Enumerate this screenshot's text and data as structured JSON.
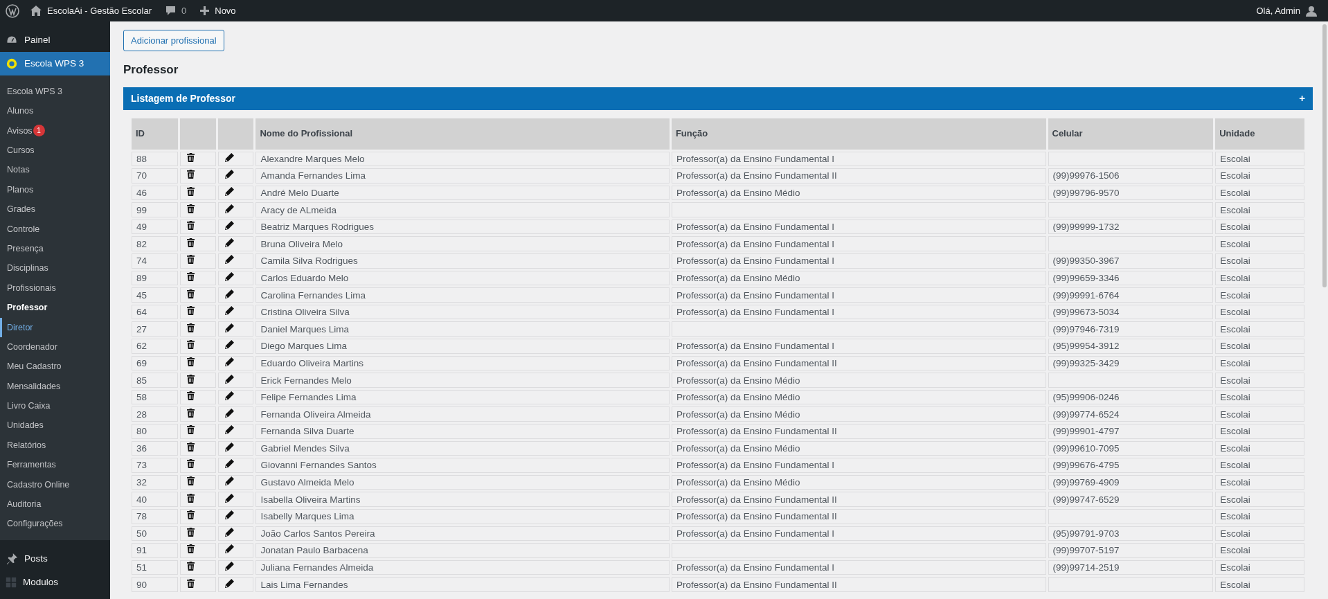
{
  "admin_bar": {
    "site_title": "EscolaAi - Gestão Escolar",
    "comments_count": "0",
    "new_label": "Novo",
    "greeting": "Olá, Admin"
  },
  "sidebar": {
    "items": [
      {
        "label": "Painel",
        "selected": false
      },
      {
        "label": "Escola WPS 3",
        "selected": true,
        "children": [
          {
            "label": "Escola WPS 3",
            "selected": false,
            "hovered": false
          },
          {
            "label": "Alunos",
            "selected": false,
            "hovered": false
          },
          {
            "label": "Avisos",
            "selected": false,
            "hovered": false,
            "badge": "1"
          },
          {
            "label": "Cursos",
            "selected": false,
            "hovered": false
          },
          {
            "label": "Notas",
            "selected": false,
            "hovered": false
          },
          {
            "label": "Planos",
            "selected": false,
            "hovered": false
          },
          {
            "label": "Grades",
            "selected": false,
            "hovered": false
          },
          {
            "label": "Controle",
            "selected": false,
            "hovered": false
          },
          {
            "label": "Presença",
            "selected": false,
            "hovered": false
          },
          {
            "label": "Disciplinas",
            "selected": false,
            "hovered": false
          },
          {
            "label": "Profissionais",
            "selected": false,
            "hovered": false
          },
          {
            "label": "Professor",
            "selected": true,
            "hovered": false
          },
          {
            "label": "Diretor",
            "selected": false,
            "hovered": true
          },
          {
            "label": "Coordenador",
            "selected": false,
            "hovered": false
          },
          {
            "label": "Meu Cadastro",
            "selected": false,
            "hovered": false
          },
          {
            "label": "Mensalidades",
            "selected": false,
            "hovered": false
          },
          {
            "label": "Livro Caixa",
            "selected": false,
            "hovered": false
          },
          {
            "label": "Unidades",
            "selected": false,
            "hovered": false
          },
          {
            "label": "Relatórios",
            "selected": false,
            "hovered": false
          },
          {
            "label": "Ferramentas",
            "selected": false,
            "hovered": false
          },
          {
            "label": "Cadastro Online",
            "selected": false,
            "hovered": false
          },
          {
            "label": "Auditoria",
            "selected": false,
            "hovered": false
          },
          {
            "label": "Configurações",
            "selected": false,
            "hovered": false
          }
        ]
      },
      {
        "label": "Posts",
        "selected": false
      },
      {
        "label": "Modulos",
        "selected": false
      }
    ]
  },
  "add_button": "Adicionar profissional",
  "page_title": "Professor",
  "panel": {
    "title": "Listagem de Professor",
    "toggle": "+"
  },
  "table": {
    "columns": [
      "ID",
      "",
      "",
      "Nome do Profissional",
      "Função",
      "Celular",
      "Unidade"
    ],
    "rows": [
      {
        "id": "88",
        "name": "Alexandre Marques Melo",
        "role": "Professor(a) da Ensino Fundamental I",
        "unit": "Escolai"
      },
      {
        "id": "70",
        "name": "Amanda Fernandes Lima",
        "role": "Professor(a) da Ensino Fundamental II",
        "phone": "(99)99976-1506",
        "unit": "Escolai"
      },
      {
        "id": "46",
        "name": "André Melo Duarte",
        "role": "Professor(a) da Ensino Médio",
        "phone": "(99)99796-9570",
        "unit": "Escolai"
      },
      {
        "id": "99",
        "name": "Aracy de ALmeida",
        "unit": "Escolai"
      },
      {
        "id": "49",
        "name": "Beatriz Marques Rodrigues",
        "role": "Professor(a) da Ensino Fundamental I",
        "phone": "(99)99999-1732",
        "unit": "Escolai"
      },
      {
        "id": "82",
        "name": "Bruna Oliveira Melo",
        "role": "Professor(a) da Ensino Fundamental I",
        "unit": "Escolai"
      },
      {
        "id": "74",
        "name": "Camila Silva Rodrigues",
        "role": "Professor(a) da Ensino Fundamental I",
        "phone": "(99)99350-3967",
        "unit": "Escolai"
      },
      {
        "id": "89",
        "name": "Carlos Eduardo Melo",
        "role": "Professor(a) da Ensino Médio",
        "phone": "(99)99659-3346",
        "unit": "Escolai"
      },
      {
        "id": "45",
        "name": "Carolina Fernandes Lima",
        "role": "Professor(a) da Ensino Fundamental I",
        "phone": "(99)99991-6764",
        "unit": "Escolai"
      },
      {
        "id": "64",
        "name": "Cristina Oliveira Silva",
        "role": "Professor(a) da Ensino Fundamental I",
        "phone": "(99)99673-5034",
        "unit": "Escolai"
      },
      {
        "id": "27",
        "name": "Daniel Marques Lima",
        "phone": "(99)97946-7319",
        "unit": "Escolai"
      },
      {
        "id": "62",
        "name": "Diego Marques Lima",
        "role": "Professor(a) da Ensino Fundamental I",
        "phone": "(95)99954-3912",
        "unit": "Escolai"
      },
      {
        "id": "69",
        "name": "Eduardo Oliveira Martins",
        "role": "Professor(a) da Ensino Fundamental II",
        "phone": "(99)99325-3429",
        "unit": "Escolai"
      },
      {
        "id": "85",
        "name": "Erick Fernandes Melo",
        "role": "Professor(a) da Ensino Médio",
        "unit": "Escolai"
      },
      {
        "id": "58",
        "name": "Felipe Fernandes Lima",
        "role": "Professor(a) da Ensino Médio",
        "phone": "(95)99906-0246",
        "unit": "Escolai"
      },
      {
        "id": "28",
        "name": "Fernanda Oliveira Almeida",
        "role": "Professor(a) da Ensino Médio",
        "phone": "(99)99774-6524",
        "unit": "Escolai"
      },
      {
        "id": "80",
        "name": "Fernanda Silva Duarte",
        "role": "Professor(a) da Ensino Fundamental II",
        "phone": "(99)99901-4797",
        "unit": "Escolai"
      },
      {
        "id": "36",
        "name": "Gabriel Mendes Silva",
        "role": "Professor(a) da Ensino Médio",
        "phone": "(99)99610-7095",
        "unit": "Escolai"
      },
      {
        "id": "73",
        "name": "Giovanni Fernandes Santos",
        "role": "Professor(a) da Ensino Fundamental I",
        "phone": "(99)99676-4795",
        "unit": "Escolai"
      },
      {
        "id": "32",
        "name": "Gustavo Almeida Melo",
        "role": "Professor(a) da Ensino Médio",
        "phone": "(99)99769-4909",
        "unit": "Escolai"
      },
      {
        "id": "40",
        "name": "Isabella Oliveira Martins",
        "role": "Professor(a) da Ensino Fundamental II",
        "phone": "(99)99747-6529",
        "unit": "Escolai"
      },
      {
        "id": "78",
        "name": "Isabelly Marques Lima",
        "role": "Professor(a) da Ensino Fundamental II",
        "unit": "Escolai"
      },
      {
        "id": "50",
        "name": "João Carlos Santos Pereira",
        "role": "Professor(a) da Ensino Fundamental I",
        "phone": "(95)99791-9703",
        "unit": "Escolai"
      },
      {
        "id": "91",
        "name": "Jonatan Paulo Barbacena",
        "phone": "(99)99707-5197",
        "unit": "Escolai"
      },
      {
        "id": "51",
        "name": "Juliana Fernandes Almeida",
        "role": "Professor(a) da Ensino Fundamental I",
        "phone": "(99)99714-2519",
        "unit": "Escolai"
      },
      {
        "id": "90",
        "name": "Lais Lima Fernandes",
        "role": "Professor(a) da Ensino Fundamental II",
        "unit": "Escolai"
      }
    ]
  }
}
